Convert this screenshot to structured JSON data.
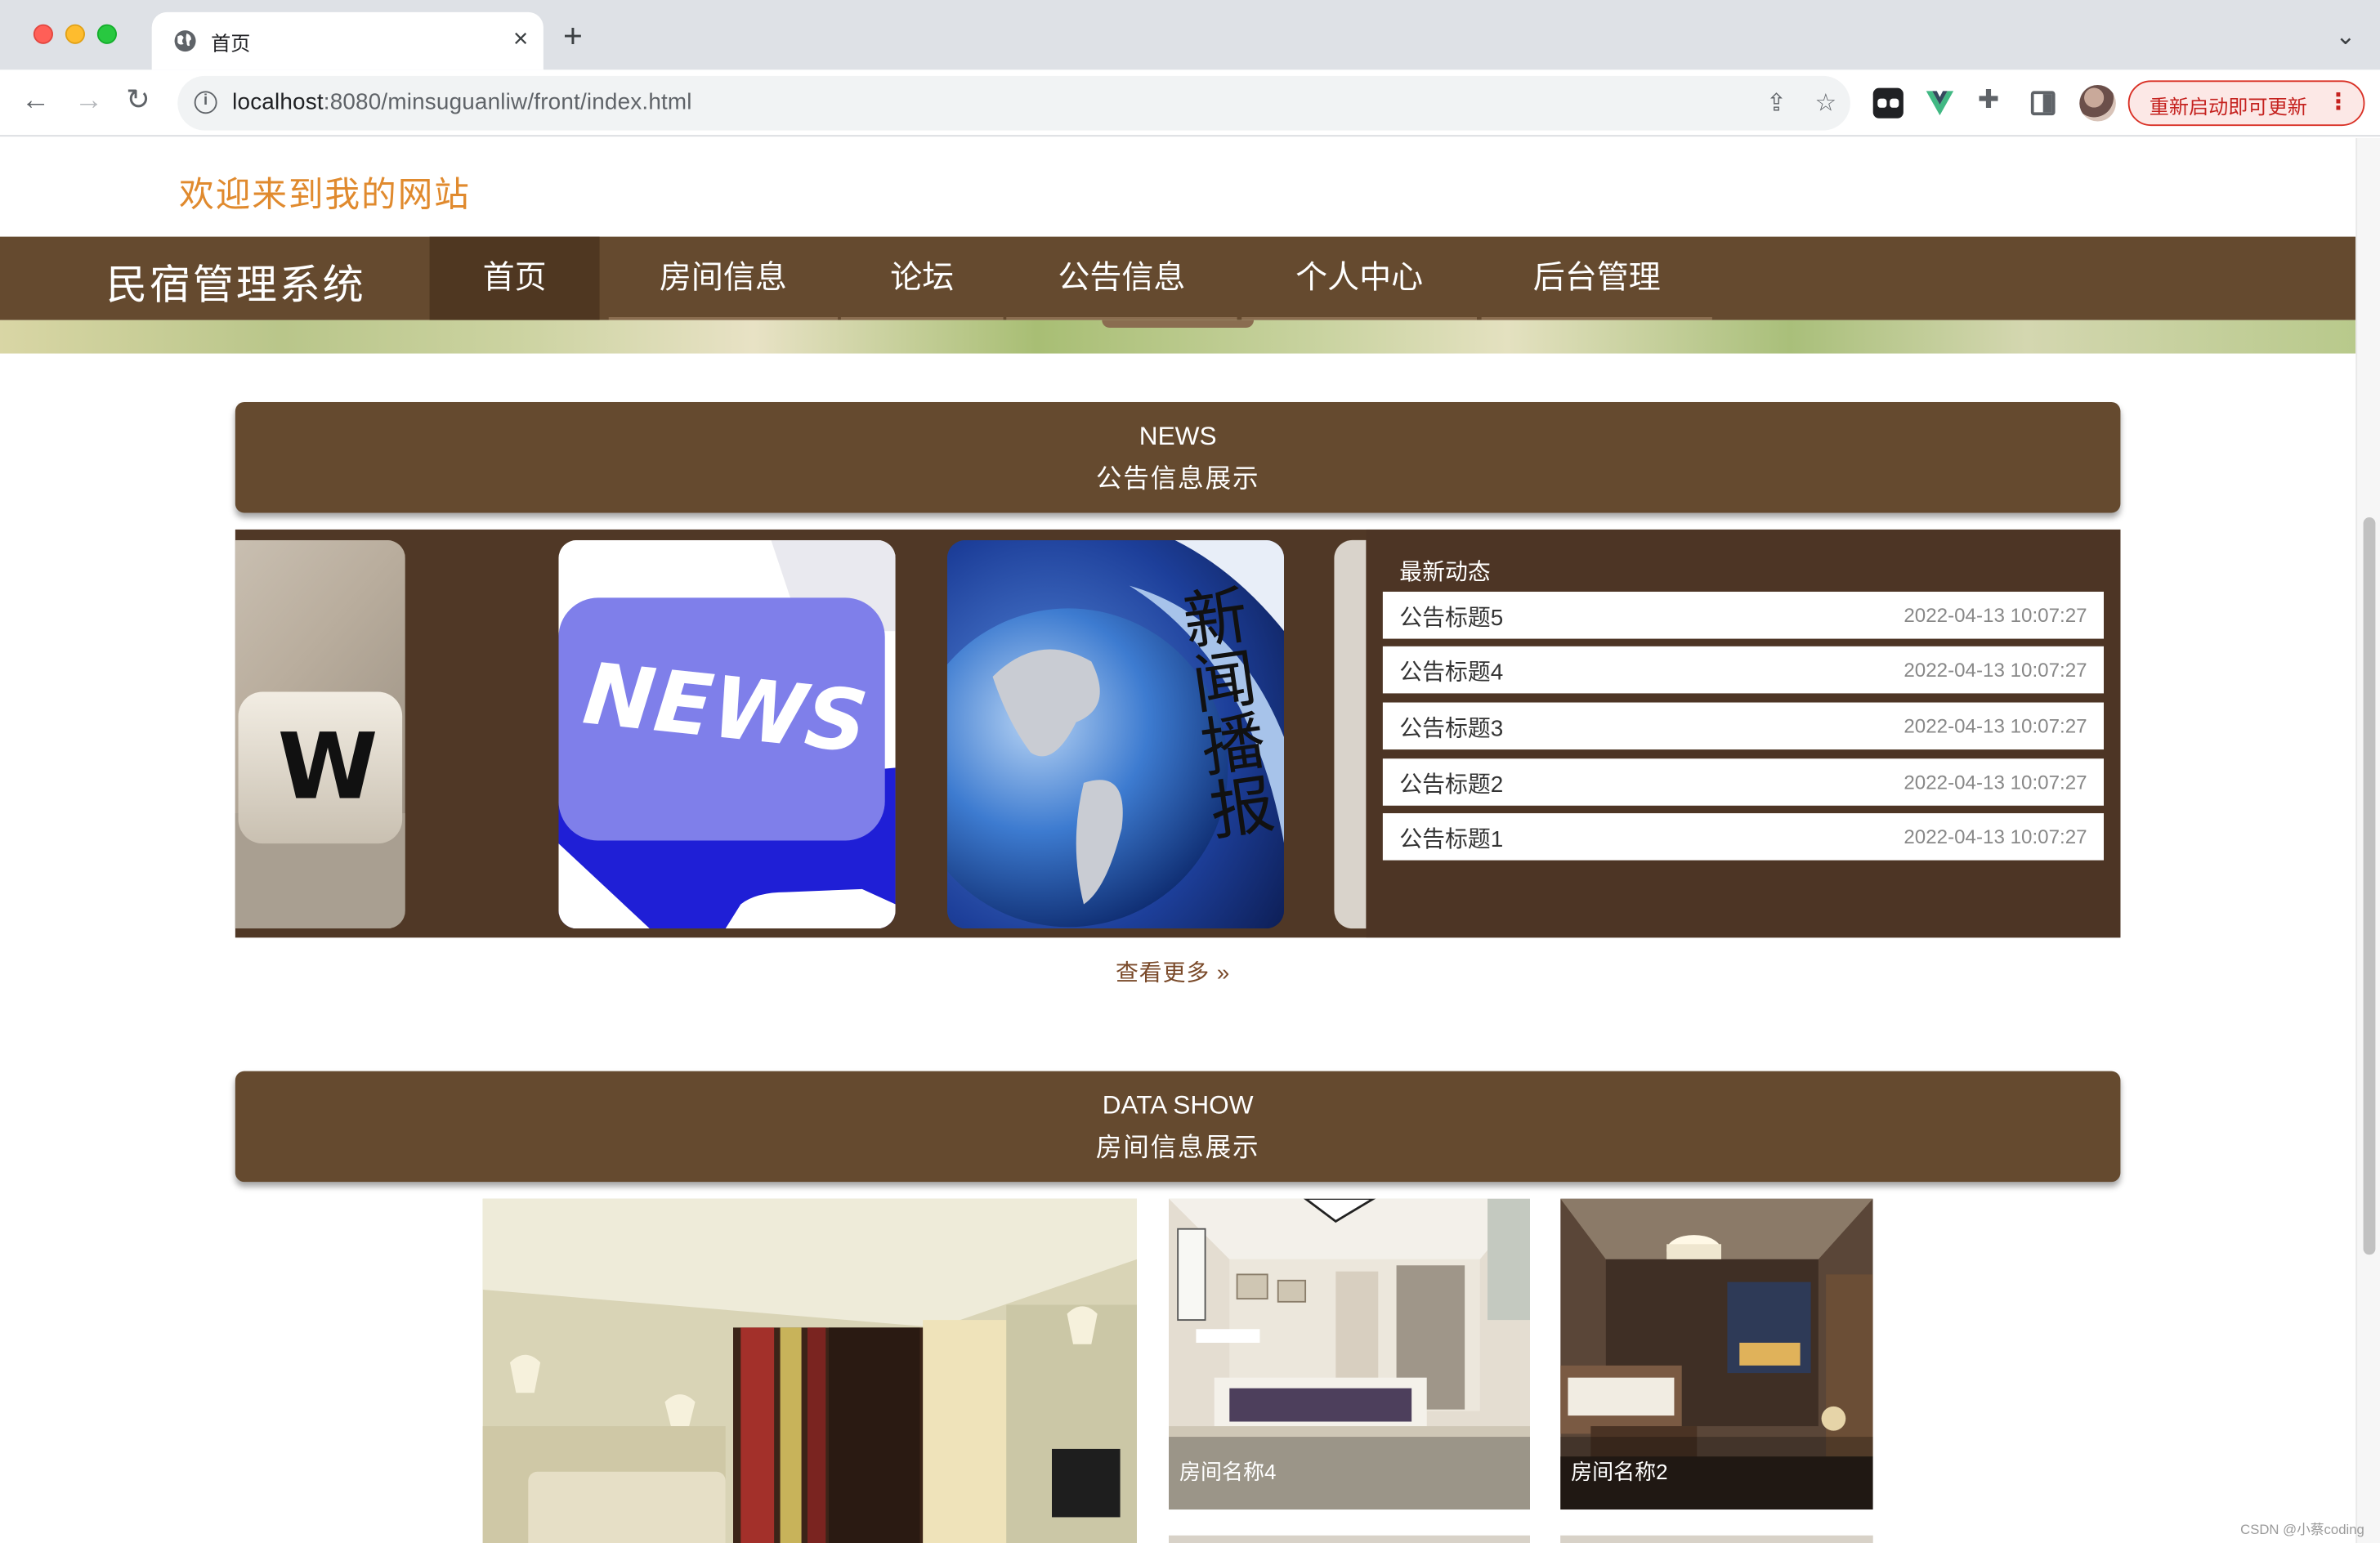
{
  "browser": {
    "tab_title": "首页",
    "tab_close": "×",
    "new_tab": "+",
    "tab_menu": "⌄",
    "url_host": "localhost",
    "url_rest": ":8080/minsuguanliw/front/index.html",
    "update_label": "重新启动即可更新",
    "icons": [
      "globe-icon",
      "back-icon",
      "forward-icon",
      "reload-icon",
      "info-icon",
      "share-icon",
      "star-icon",
      "extension-icon",
      "puzzle-icon",
      "sidepanel-icon",
      "avatar"
    ]
  },
  "site": {
    "welcome": "欢迎来到我的网站",
    "brand": "民宿管理系统",
    "nav": [
      "首页",
      "房间信息",
      "论坛",
      "公告信息",
      "个人中心",
      "后台管理"
    ],
    "active_nav": "首页"
  },
  "news_section": {
    "en": "NEWS",
    "zh": "公告信息展示",
    "card_texts": [
      "E W",
      "NEWS",
      "新闻播报"
    ],
    "latest_title": "最新动态",
    "items": [
      {
        "title": "公告标题5",
        "date": "2022-04-13 10:07:27"
      },
      {
        "title": "公告标题4",
        "date": "2022-04-13 10:07:27"
      },
      {
        "title": "公告标题3",
        "date": "2022-04-13 10:07:27"
      },
      {
        "title": "公告标题2",
        "date": "2022-04-13 10:07:27"
      },
      {
        "title": "公告标题1",
        "date": "2022-04-13 10:07:27"
      }
    ],
    "more": "查看更多 »"
  },
  "data_section": {
    "en": "DATA SHOW",
    "zh": "房间信息展示",
    "rooms": [
      "房间名称4",
      "房间名称2"
    ]
  },
  "watermark": "CSDN @小蔡coding",
  "colors": {
    "nav_bg": "#654a2f",
    "nav_active": "#4f3721",
    "panel_bg": "#503826",
    "welcome": "#e08a2e",
    "update_red": "#c5221f"
  }
}
